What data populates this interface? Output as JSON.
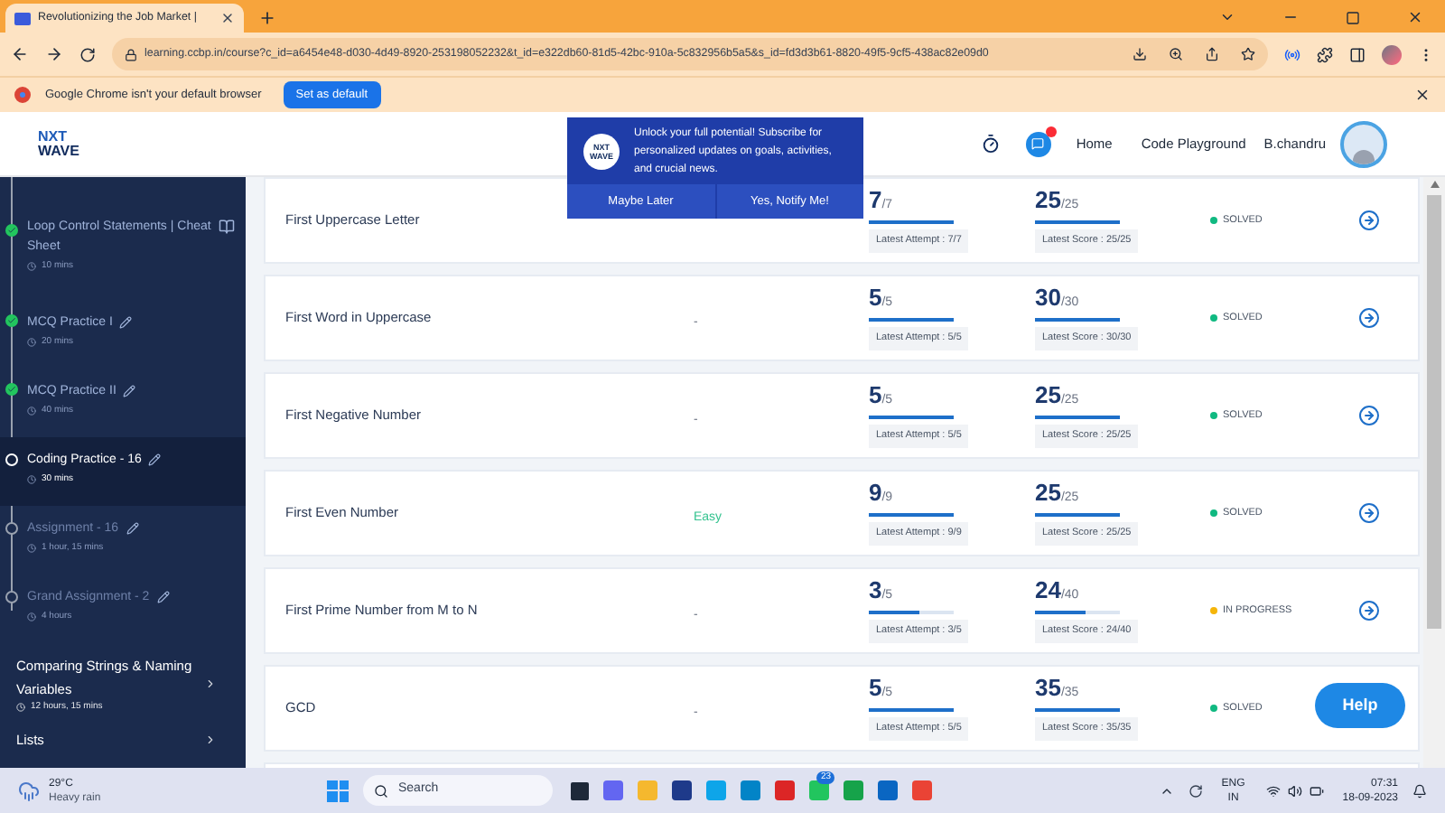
{
  "browser": {
    "tab_title": "Revolutionizing the Job Market |",
    "url": "learning.ccbp.in/course?c_id=a6454e48-d030-4d49-8920-253198052232&t_id=e322db60-81d5-42bc-910a-5c832956b5a5&s_id=fd3d3b61-8820-49f5-9cf5-438ac82e09d0"
  },
  "infobar": {
    "message": "Google Chrome isn't your default browser",
    "button": "Set as default"
  },
  "header": {
    "logo_top": "NXT",
    "logo_bottom": "WAVE",
    "nav": [
      "Home",
      "Code Playground"
    ],
    "user": "B.chandru"
  },
  "popup": {
    "logo": "NXT WAVE",
    "message": "Unlock your full potential! Subscribe for personalized updates on goals, activities, and crucial news.",
    "buttons": [
      "Maybe Later",
      "Yes, Notify Me!"
    ]
  },
  "sidebar": {
    "items": [
      {
        "title": "Loop Control Statements | Cheat Sheet",
        "duration": "10 mins",
        "done": true,
        "selected": false,
        "kind": "reading"
      },
      {
        "title": "MCQ Practice I",
        "duration": "20 mins",
        "done": true,
        "selected": false,
        "kind": "practice"
      },
      {
        "title": "MCQ Practice II",
        "duration": "40 mins",
        "done": true,
        "selected": false,
        "kind": "practice"
      },
      {
        "title": "Coding Practice - 16",
        "duration": "30 mins",
        "done": false,
        "selected": true,
        "kind": "practice"
      },
      {
        "title": "Assignment - 16",
        "duration": "1 hour, 15 mins",
        "done": false,
        "selected": false,
        "kind": "practice"
      },
      {
        "title": "Grand Assignment - 2",
        "duration": "4 hours",
        "done": false,
        "selected": false,
        "kind": "practice"
      }
    ],
    "sections": [
      {
        "title": "Comparing Strings & Naming Variables",
        "duration": "12 hours, 15 mins"
      },
      {
        "title": "Lists"
      }
    ]
  },
  "questions": [
    {
      "title": "First Uppercase Letter",
      "attempt": {
        "value": "7",
        "total": "/7",
        "level": 1,
        "label": "Latest Attempt : 7/7"
      },
      "score": {
        "value": "25",
        "total": "/25",
        "level": 1,
        "label": "Latest Score : 25/25"
      },
      "status": "SOLVED",
      "color": "#10b981"
    },
    {
      "title": "First Word in Uppercase",
      "difficulty": "-",
      "attempt": {
        "value": "5",
        "total": "/5",
        "level": 1,
        "label": "Latest Attempt : 5/5"
      },
      "score": {
        "value": "30",
        "total": "/30",
        "level": 1,
        "label": "Latest Score : 30/30"
      },
      "status": "SOLVED",
      "color": "#10b981"
    },
    {
      "title": "First Negative Number",
      "difficulty": "-",
      "attempt": {
        "value": "5",
        "total": "/5",
        "level": 1,
        "label": "Latest Attempt : 5/5"
      },
      "score": {
        "value": "25",
        "total": "/25",
        "level": 1,
        "label": "Latest Score : 25/25"
      },
      "status": "SOLVED",
      "color": "#10b981"
    },
    {
      "title": "First Even Number",
      "difficulty": "Easy",
      "attempt": {
        "value": "9",
        "total": "/9",
        "level": 1,
        "label": "Latest Attempt : 9/9"
      },
      "score": {
        "value": "25",
        "total": "/25",
        "level": 1,
        "label": "Latest Score : 25/25"
      },
      "status": "SOLVED",
      "color": "#10b981"
    },
    {
      "title": "First Prime Number from M to N",
      "difficulty": "-",
      "attempt": {
        "value": "3",
        "total": "/5",
        "level": 0.6,
        "label": "Latest Attempt : 3/5"
      },
      "score": {
        "value": "24",
        "total": "/40",
        "level": 0.6,
        "label": "Latest Score : 24/40"
      },
      "status": "IN PROGRESS",
      "color": "#f5b50a"
    },
    {
      "title": "GCD",
      "difficulty": "-",
      "attempt": {
        "value": "5",
        "total": "/5",
        "level": 1,
        "label": "Latest Attempt : 5/5"
      },
      "score": {
        "value": "35",
        "total": "/35",
        "level": 1,
        "label": "Latest Score : 35/35"
      },
      "status": "SOLVED",
      "color": "#10b981",
      "arrow": false
    }
  ],
  "help": "Help",
  "taskbar": {
    "temperature": "29°C",
    "weather": "Heavy rain",
    "search": "Search",
    "whatsapp_badge": "23",
    "language": "ENG",
    "region": "IN",
    "time": "07:31",
    "date": "18-09-2023"
  }
}
